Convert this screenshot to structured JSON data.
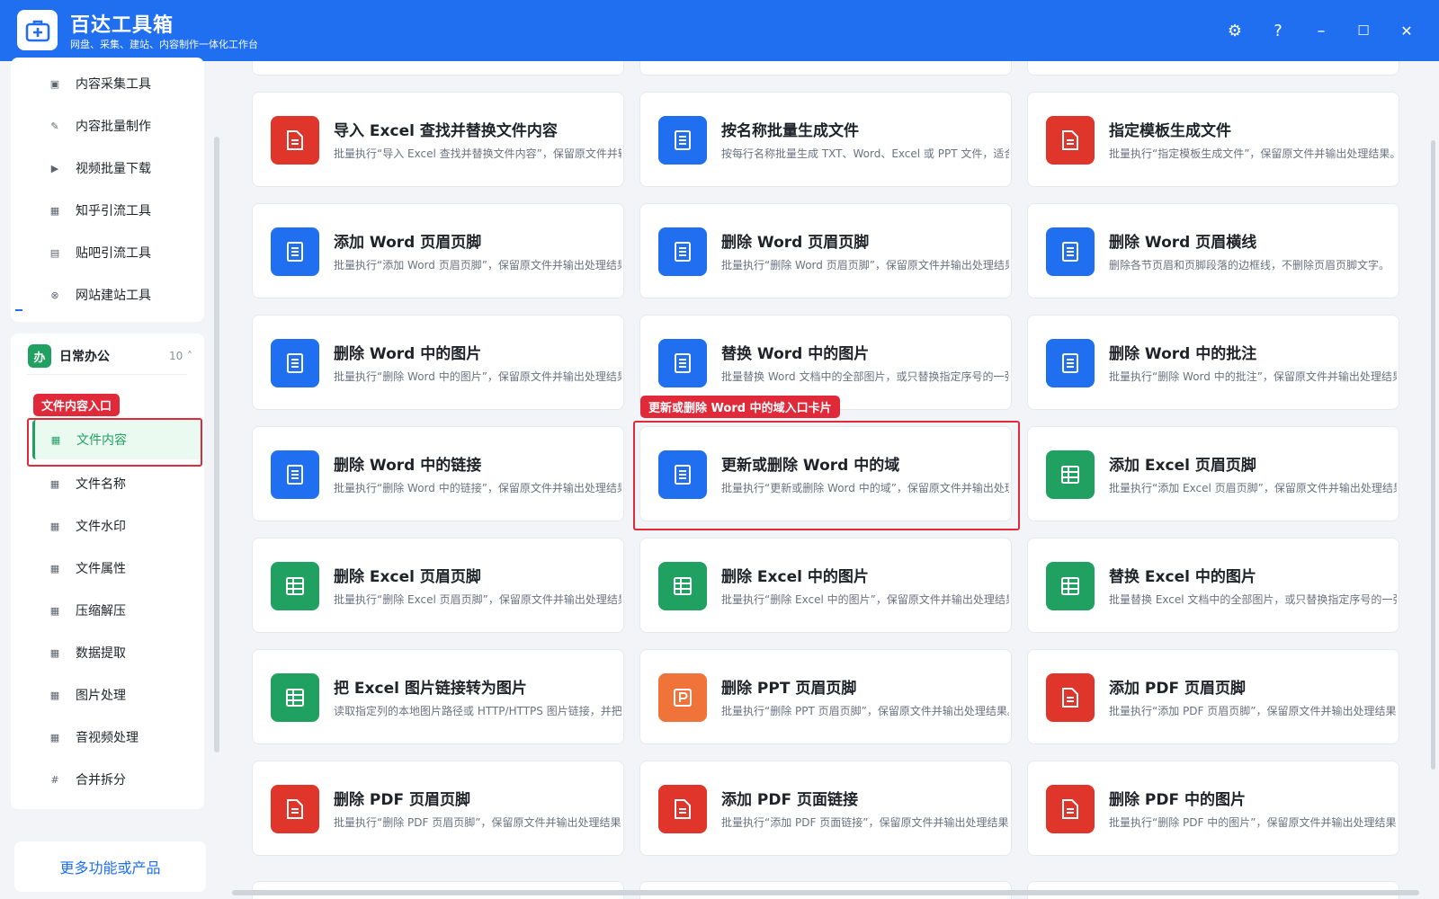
{
  "app": {
    "title": "百达工具箱",
    "subtitle": "网盘、采集、建站、内容制作一体化工作台",
    "controls": {
      "settings": "⚙",
      "help": "?",
      "minimize": "–",
      "maximize": "☐",
      "close": "✕"
    }
  },
  "sidebar": {
    "top_items": [
      {
        "label": "内容采集工具",
        "icon": "collect-icon"
      },
      {
        "label": "内容批量制作",
        "icon": "pen-icon"
      },
      {
        "label": "视频批量下载",
        "icon": "video-icon"
      },
      {
        "label": "知乎引流工具",
        "icon": "zhihu-icon"
      },
      {
        "label": "贴吧引流工具",
        "icon": "tieba-icon"
      },
      {
        "label": "网站建站工具",
        "icon": "site-icon"
      }
    ],
    "group": {
      "badge": "办",
      "label": "日常办公",
      "count": "10",
      "chevron": "˄"
    },
    "group_items": [
      {
        "label": "文件内容",
        "icon": "grid-icon"
      },
      {
        "label": "文件名称",
        "icon": "grid-icon"
      },
      {
        "label": "文件水印",
        "icon": "grid-icon"
      },
      {
        "label": "文件属性",
        "icon": "grid-icon"
      },
      {
        "label": "压缩解压",
        "icon": "grid-icon"
      },
      {
        "label": "数据提取",
        "icon": "grid-icon"
      },
      {
        "label": "图片处理",
        "icon": "grid-icon"
      },
      {
        "label": "音视频处理",
        "icon": "grid-icon"
      },
      {
        "label": "合并拆分",
        "icon": "hash-icon"
      }
    ],
    "active_item": "文件内容",
    "more_button": "更多功能或产品"
  },
  "annotations": {
    "sidebar_tag": "文件内容入口",
    "card_tag": "更新或删除 Word 中的域入口卡片"
  },
  "colors": {
    "brand": "#1f6ff0",
    "word": "#1f6ff0",
    "excel": "#20a162",
    "pdf": "#e0352b",
    "ppt": "#f0743a",
    "highlight": "#e02a3a"
  },
  "cards": [
    {
      "title": "导入 Excel 查找并替换文件内容",
      "desc": "批量执行“导入 Excel 查找并替换文件内容”，保留原文件并输出处理结果。",
      "type": "pdf"
    },
    {
      "title": "按名称批量生成文件",
      "desc": "按每行名称批量生成 TXT、Word、Excel 或 PPT 文件，适合批量建档。",
      "type": "word"
    },
    {
      "title": "指定模板生成文件",
      "desc": "批量执行“指定模板生成文件”，保留原文件并输出处理结果。",
      "type": "pdf"
    },
    {
      "title": "添加 Word 页眉页脚",
      "desc": "批量执行“添加 Word 页眉页脚”，保留原文件并输出处理结果。",
      "type": "word"
    },
    {
      "title": "删除 Word 页眉页脚",
      "desc": "批量执行“删除 Word 页眉页脚”，保留原文件并输出处理结果。",
      "type": "word"
    },
    {
      "title": "删除 Word 页眉横线",
      "desc": "删除各节页眉和页脚段落的边框线，不删除页眉页脚文字。",
      "type": "word"
    },
    {
      "title": "删除 Word 中的图片",
      "desc": "批量执行“删除 Word 中的图片”，保留原文件并输出处理结果。",
      "type": "word"
    },
    {
      "title": "替换 Word 中的图片",
      "desc": "批量替换 Word 文档中的全部图片，或只替换指定序号的一张图片。",
      "type": "word"
    },
    {
      "title": "删除 Word 中的批注",
      "desc": "批量执行“删除 Word 中的批注”，保留原文件并输出处理结果。",
      "type": "word"
    },
    {
      "title": "删除 Word 中的链接",
      "desc": "批量执行“删除 Word 中的链接”，保留原文件并输出处理结果。",
      "type": "word"
    },
    {
      "title": "更新或删除 Word 中的域",
      "desc": "批量执行“更新或删除 Word 中的域”，保留原文件并输出处理结果。",
      "type": "word"
    },
    {
      "title": "添加 Excel 页眉页脚",
      "desc": "批量执行“添加 Excel 页眉页脚”，保留原文件并输出处理结果。",
      "type": "excel"
    },
    {
      "title": "删除 Excel 页眉页脚",
      "desc": "批量执行“删除 Excel 页眉页脚”，保留原文件并输出处理结果。",
      "type": "excel"
    },
    {
      "title": "删除 Excel 中的图片",
      "desc": "批量执行“删除 Excel 中的图片”，保留原文件并输出处理结果。",
      "type": "excel"
    },
    {
      "title": "替换 Excel 中的图片",
      "desc": "批量替换 Excel 文档中的全部图片，或只替换指定序号的一张图片。",
      "type": "excel"
    },
    {
      "title": "把 Excel 图片链接转为图片",
      "desc": "读取指定列的本地图片路径或 HTTP/HTTPS 图片链接，并把图片插入表格。",
      "type": "excel"
    },
    {
      "title": "删除 PPT 页眉页脚",
      "desc": "批量执行“删除 PPT 页眉页脚”，保留原文件并输出处理结果。",
      "type": "ppt"
    },
    {
      "title": "添加 PDF 页眉页脚",
      "desc": "批量执行“添加 PDF 页眉页脚”，保留原文件并输出处理结果。",
      "type": "pdf"
    },
    {
      "title": "删除 PDF 页眉页脚",
      "desc": "批量执行“删除 PDF 页眉页脚”，保留原文件并输出处理结果。",
      "type": "pdf"
    },
    {
      "title": "添加 PDF 页面链接",
      "desc": "批量执行“添加 PDF 页面链接”，保留原文件并输出处理结果。",
      "type": "pdf"
    },
    {
      "title": "删除 PDF 中的图片",
      "desc": "批量执行“删除 PDF 中的图片”，保留原文件并输出处理结果。",
      "type": "pdf"
    }
  ]
}
